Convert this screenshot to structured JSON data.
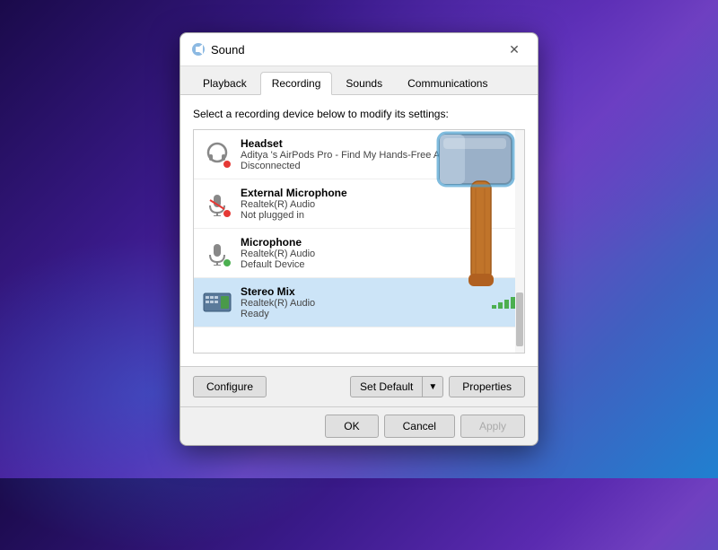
{
  "dialog": {
    "title": "Sound",
    "close_label": "✕"
  },
  "tabs": [
    {
      "id": "playback",
      "label": "Playback",
      "active": false
    },
    {
      "id": "recording",
      "label": "Recording",
      "active": true
    },
    {
      "id": "sounds",
      "label": "Sounds",
      "active": false
    },
    {
      "id": "communications",
      "label": "Communications",
      "active": false
    }
  ],
  "content": {
    "instruction": "Select a recording device below to modify its settings:",
    "devices": [
      {
        "id": "headset",
        "name": "Headset",
        "driver": "Aditya 's AirPods Pro - Find My Hands-Free AG Audio",
        "status": "Disconnected",
        "icon": "headset",
        "status_dot": "red",
        "selected": false
      },
      {
        "id": "ext-mic",
        "name": "External Microphone",
        "driver": "Realtek(R) Audio",
        "status": "Not plugged in",
        "icon": "mic-x",
        "status_dot": "red",
        "selected": false
      },
      {
        "id": "microphone",
        "name": "Microphone",
        "driver": "Realtek(R) Audio",
        "status": "Default Device",
        "icon": "mic-check",
        "status_dot": "green",
        "selected": false
      },
      {
        "id": "stereo-mix",
        "name": "Stereo Mix",
        "driver": "Realtek(R) Audio",
        "status": "Ready",
        "icon": "board",
        "status_dot": null,
        "selected": true
      }
    ]
  },
  "actions": {
    "configure_label": "Configure",
    "set_default_label": "Set Default",
    "properties_label": "Properties"
  },
  "footer": {
    "ok_label": "OK",
    "cancel_label": "Cancel",
    "apply_label": "Apply"
  }
}
